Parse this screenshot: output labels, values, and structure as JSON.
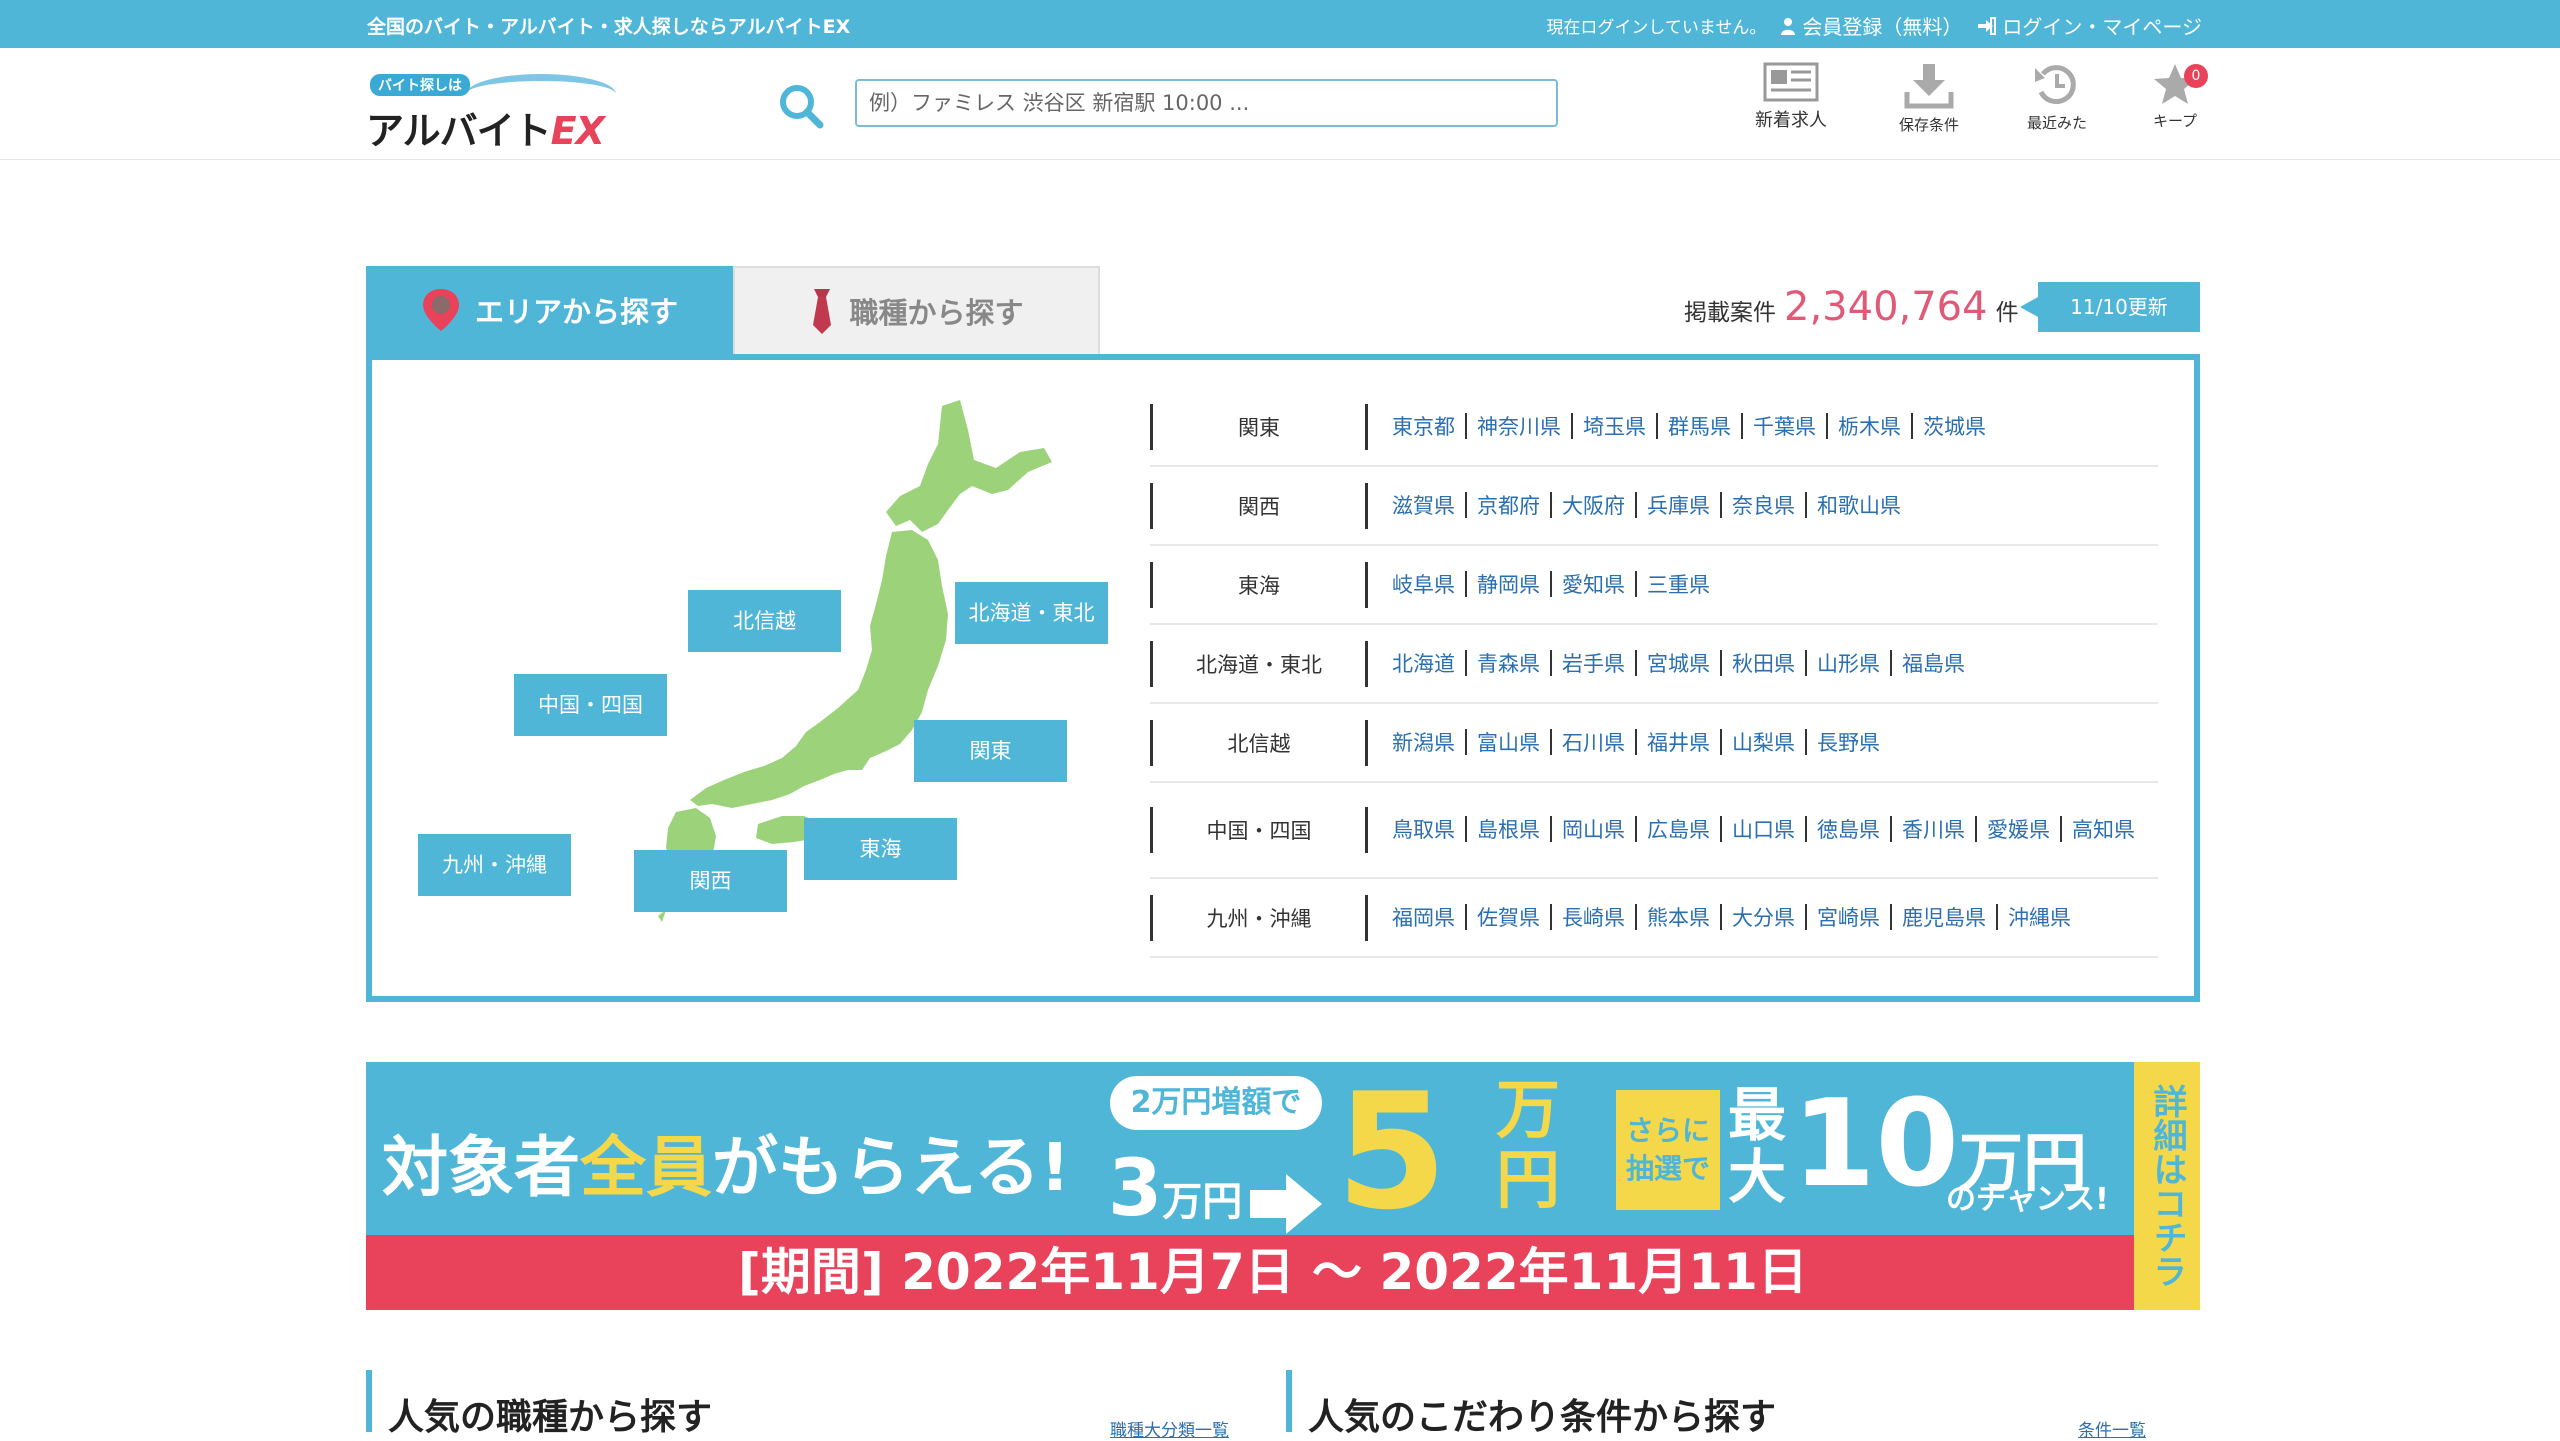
{
  "topbar": {
    "tagline": "全国のバイト・アルバイト・求人探しならアルバイトEX",
    "login_status": "現在ログインしていません。",
    "register_link": "会員登録（無料）",
    "login_link": "ログイン・マイページ"
  },
  "header": {
    "logo_small": "バイト探しは",
    "logo_main": "アルバイト",
    "logo_ex": "EX",
    "search_placeholder": "例）ファミレス 渋谷区 新宿駅 10:00 ...",
    "nav": {
      "new_jobs": "新着求人",
      "saved_conditions": "保存条件",
      "recently_viewed": "最近みた",
      "keep": "キープ",
      "keep_count": "0"
    }
  },
  "tabs": {
    "area": "エリアから探す",
    "occupation": "職種から探す"
  },
  "listing": {
    "prefix": "掲載案件",
    "count": "2,340,764",
    "suffix": "件",
    "updated": "11/10更新"
  },
  "map_regions": {
    "hokushinetsu": "北信越",
    "hokkaido_tohoku": "北海道・東北",
    "chugoku_shikoku": "中国・四国",
    "kanto": "関東",
    "tokai": "東海",
    "kyushu_okinawa": "九州・沖縄",
    "kansai": "関西"
  },
  "regions": [
    {
      "name": "関東",
      "prefs": [
        "東京都",
        "神奈川県",
        "埼玉県",
        "群馬県",
        "千葉県",
        "栃木県",
        "茨城県"
      ]
    },
    {
      "name": "関西",
      "prefs": [
        "滋賀県",
        "京都府",
        "大阪府",
        "兵庫県",
        "奈良県",
        "和歌山県"
      ]
    },
    {
      "name": "東海",
      "prefs": [
        "岐阜県",
        "静岡県",
        "愛知県",
        "三重県"
      ]
    },
    {
      "name": "北海道・東北",
      "prefs": [
        "北海道",
        "青森県",
        "岩手県",
        "宮城県",
        "秋田県",
        "山形県",
        "福島県"
      ]
    },
    {
      "name": "北信越",
      "prefs": [
        "新潟県",
        "富山県",
        "石川県",
        "福井県",
        "山梨県",
        "長野県"
      ]
    },
    {
      "name": "中国・四国",
      "prefs": [
        "鳥取県",
        "島根県",
        "岡山県",
        "広島県",
        "山口県",
        "徳島県",
        "香川県",
        "愛媛県",
        "高知県"
      ]
    },
    {
      "name": "九州・沖縄",
      "prefs": [
        "福岡県",
        "佐賀県",
        "長崎県",
        "熊本県",
        "大分県",
        "宮崎県",
        "鹿児島県",
        "沖縄県"
      ]
    }
  ],
  "banner": {
    "main_a": "対象者",
    "main_b": "全員",
    "main_c": "がもらえる!",
    "bubble": "2万円増額で",
    "from_amount": "3",
    "from_unit": "万円",
    "to_amount": "5",
    "to_unit": "万円",
    "sarani": "さらに抽選で",
    "max": "最大",
    "max_amount": "10",
    "max_unit": "万円",
    "chance": "のチャンス!",
    "period": "[期間] 2022年11月7日 ～ 2022年11月11日",
    "side": "詳細はコチラ"
  },
  "sections": {
    "popular_occupation": "人気の職種から探す",
    "occupation_more": "職種大分類一覧",
    "popular_conditions": "人気のこだわり条件から探す",
    "conditions_more": "条件一覧"
  },
  "colors": {
    "brand_blue": "#4fb6d8",
    "accent_red": "#e8435a",
    "map_green": "#9cd27a",
    "count_pink": "#e05a77",
    "banner_yellow": "#f5d84a"
  }
}
